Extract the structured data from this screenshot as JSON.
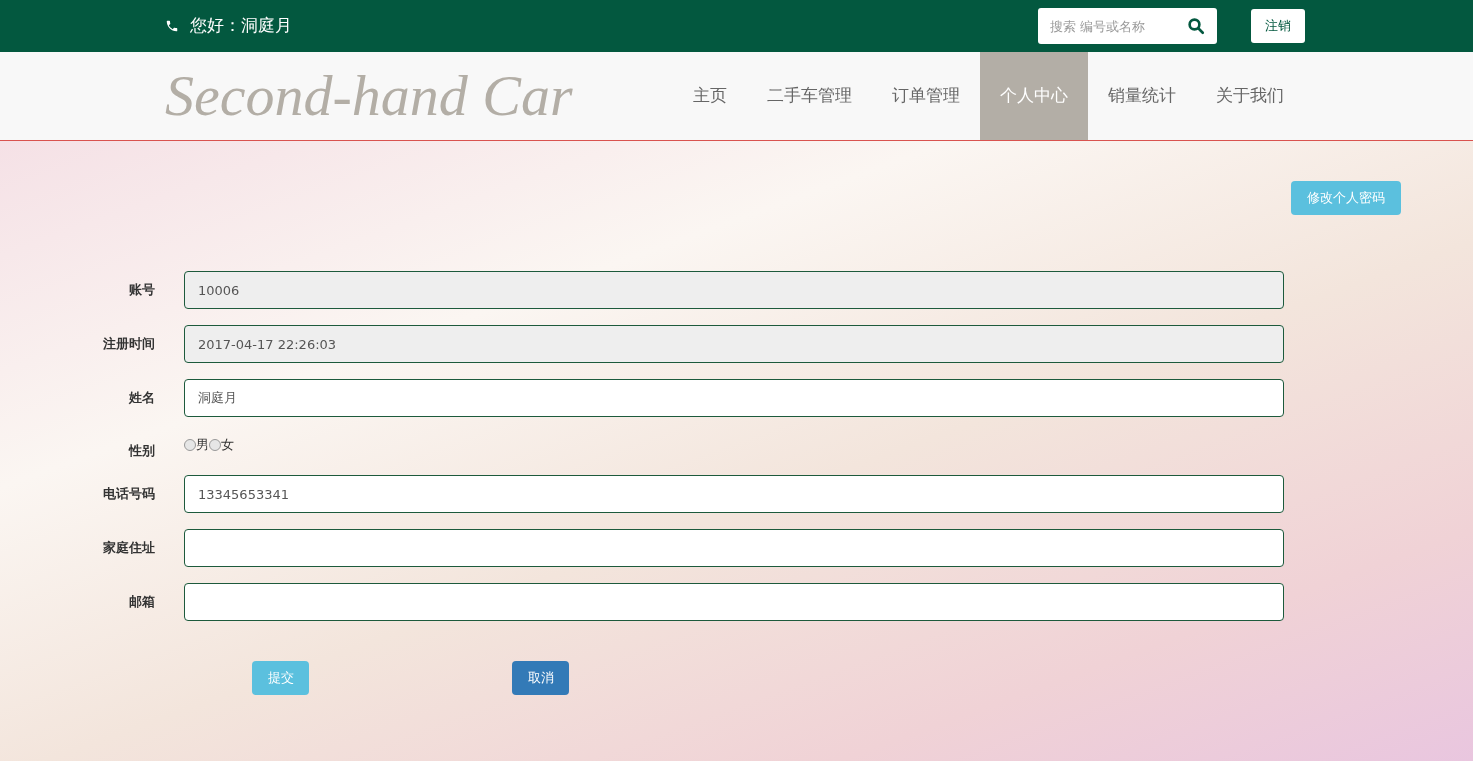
{
  "top_bar": {
    "greeting": "您好：洞庭月",
    "search": {
      "placeholder": "搜索 编号或名称"
    },
    "logout": "注销"
  },
  "nav": {
    "logo": "Second-hand Car",
    "items": [
      {
        "label": "主页",
        "selected": false
      },
      {
        "label": "二手车管理",
        "selected": false
      },
      {
        "label": "订单管理",
        "selected": false
      },
      {
        "label": "个人中心",
        "selected": true
      },
      {
        "label": "销量统计",
        "selected": false
      },
      {
        "label": "关于我们",
        "selected": false
      }
    ]
  },
  "change_password": "修改个人密码",
  "form": [
    {
      "kind": "text",
      "label": "账号",
      "value": "10006",
      "disabled": true
    },
    {
      "kind": "text",
      "label": "注册时间",
      "value": "2017-04-17 22:26:03",
      "disabled": true
    },
    {
      "kind": "text",
      "label": "姓名",
      "value": "洞庭月",
      "disabled": false
    },
    {
      "kind": "radio",
      "label": "性别",
      "options": [
        {
          "label": "男",
          "selected": false
        },
        {
          "label": "女",
          "selected": false
        }
      ]
    },
    {
      "kind": "text",
      "label": "电话号码",
      "value": "13345653341",
      "disabled": false
    },
    {
      "kind": "text",
      "label": "家庭住址",
      "disabled": false
    },
    {
      "kind": "text",
      "label": "邮箱",
      "disabled": false
    }
  ],
  "buttons": {
    "submit": "提交",
    "cancel": "取消"
  }
}
